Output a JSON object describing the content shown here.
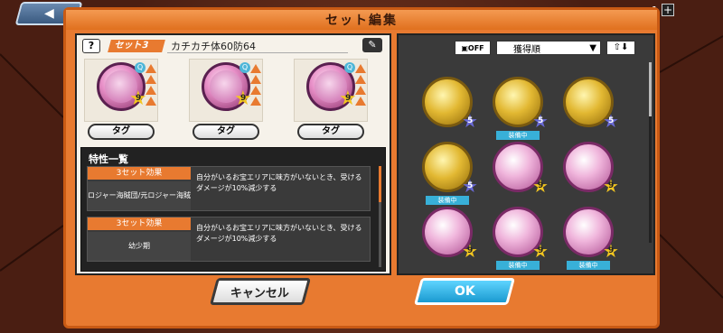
{
  "title": "セット編集",
  "back_label": "◀",
  "topright_count": "1",
  "topright_plus": "+",
  "left": {
    "help_label": "?",
    "set_label": "セット3",
    "set_name": "カチカチ体60防64",
    "edit_icon": "pencil-icon",
    "medals": [
      {
        "rank": "9",
        "tag_label": "タグ",
        "badge": "Q"
      },
      {
        "rank": "9",
        "tag_label": "タグ",
        "badge": "Q"
      },
      {
        "rank": "9",
        "tag_label": "タグ",
        "badge": "Q"
      }
    ],
    "traits_title": "特性一覧",
    "traits": [
      {
        "effect": "3セット効果",
        "group": "ロジャー海賊団/元ロジャー海賊団",
        "desc": "自分がいるお宝エリアに味方がいないとき、受けるダメージが10%減少する"
      },
      {
        "effect": "3セット効果",
        "group": "幼少期",
        "desc": "自分がいるお宝エリアに味方がいないとき、受けるダメージが10%減少する"
      }
    ]
  },
  "right": {
    "filter_off": "OFF",
    "sort_value": "獲得順",
    "sort_icon": "chevron-down-icon",
    "order_label": "⇧⬇",
    "grid": [
      {
        "kind": "gold",
        "rank": "5",
        "equipped": false
      },
      {
        "kind": "gold",
        "rank": "5",
        "equipped": true
      },
      {
        "kind": "gold",
        "rank": "5",
        "equipped": false
      },
      {
        "kind": "gold",
        "rank": "5",
        "equipped": true
      },
      {
        "kind": "pink",
        "rank": "9",
        "equipped": false
      },
      {
        "kind": "pink",
        "rank": "9",
        "equipped": false
      },
      {
        "kind": "pink",
        "rank": "9",
        "equipped": false
      },
      {
        "kind": "pink",
        "rank": "9",
        "equipped": true
      },
      {
        "kind": "pink",
        "rank": "9",
        "equipped": true
      }
    ],
    "equip_label": "装備中"
  },
  "cancel_label": "キャンセル",
  "ok_label": "OK",
  "colors": {
    "accent": "#e87a30",
    "ok": "#1a9ad0"
  }
}
